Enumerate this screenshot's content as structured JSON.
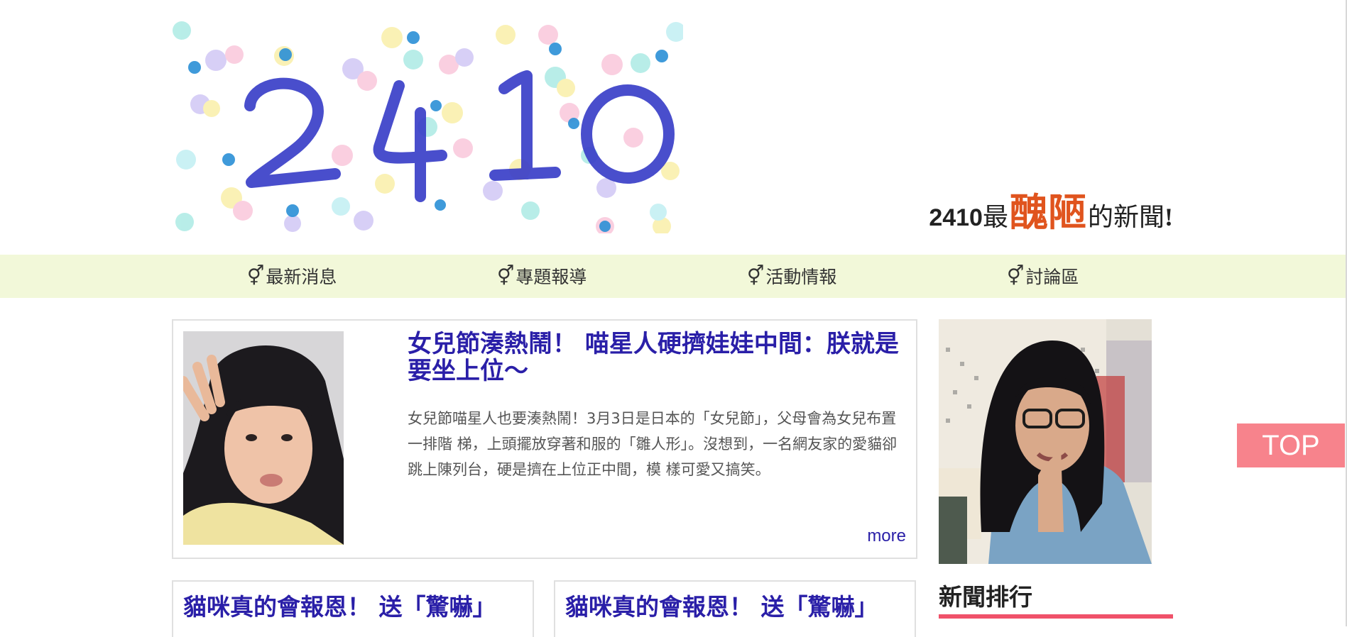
{
  "header": {
    "logo_text": "2410",
    "tagline_num": "2410",
    "tagline_pre": "最",
    "tagline_highlight": "醜陋",
    "tagline_post": "的新聞",
    "tagline_end": "!"
  },
  "nav": {
    "items": [
      {
        "symbol": "⚥",
        "label": "最新消息"
      },
      {
        "symbol": "⚥",
        "label": "專題報導"
      },
      {
        "symbol": "⚥",
        "label": "活動情報"
      },
      {
        "symbol": "⚥",
        "label": "討論區"
      }
    ]
  },
  "featured": {
    "title": "女兒節湊熱鬧！ 喵星人硬擠娃娃中間：朕就是要坐上位～",
    "body": "女兒節喵星人也要湊熱鬧！3月3日是日本的「女兒節」，父母會為女兒布置一排階 梯，上頭擺放穿著和服的「雛人形」。沒想到，一名網友家的愛貓卻跳上陳列台，硬是擠在上位正中間，模 樣可愛又搞笑。",
    "more_label": "more"
  },
  "subcards": [
    {
      "title": "貓咪真的會報恩！ 送「驚嚇」"
    },
    {
      "title": "貓咪真的會報恩！ 送「驚嚇」"
    }
  ],
  "ranking": {
    "title": "新聞排行"
  },
  "top_button": {
    "label": "TOP"
  },
  "colors": {
    "nav_bg": "#f2f8d9",
    "title_blue": "#2a1fa8",
    "highlight_orange": "#e0541e",
    "rank_underline": "#f0526a",
    "top_button_bg": "#f7838c"
  }
}
